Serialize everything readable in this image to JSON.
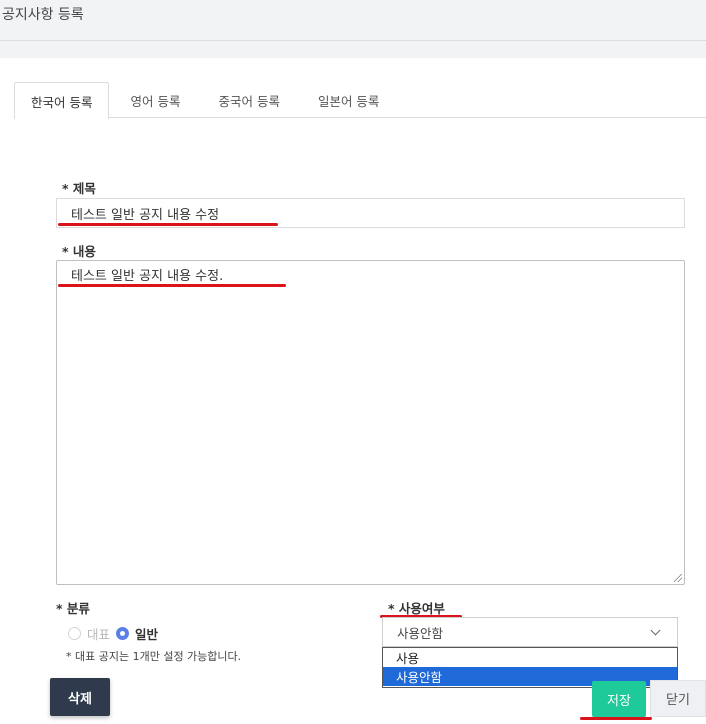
{
  "page": {
    "title": "공지사항 등록"
  },
  "tabs": [
    {
      "label": "한국어 등록",
      "active": true
    },
    {
      "label": "영어 등록"
    },
    {
      "label": "중국어 등록"
    },
    {
      "label": "일본어 등록"
    }
  ],
  "form": {
    "title_label": "* 제목",
    "title_value": "테스트 일반 공지 내용 수정",
    "content_label": "* 내용",
    "content_value": "테스트 일반 공지 내용 수정.",
    "category_label": "* 분류",
    "category_options": [
      {
        "label": "대표",
        "checked": false,
        "disabled": true
      },
      {
        "label": "일반",
        "checked": true
      }
    ],
    "category_hint": "* 대표 공지는 1개만 설정 가능합니다.",
    "usage_label": "* 사용여부",
    "usage_selected": "사용안함",
    "usage_options": [
      {
        "label": "사용",
        "selected": false
      },
      {
        "label": "사용안함",
        "selected": true
      }
    ]
  },
  "buttons": {
    "delete": "삭제",
    "save": "저장",
    "close": "닫기"
  },
  "colors": {
    "annotation_red": "#d9141b",
    "save_green": "#1ec99a",
    "delete_dark": "#2f3a4c",
    "dropdown_highlight": "#1f6ad8",
    "radio_checked": "#5a7fe8"
  },
  "icons": {
    "select_arrow": "chevron-down-icon"
  }
}
